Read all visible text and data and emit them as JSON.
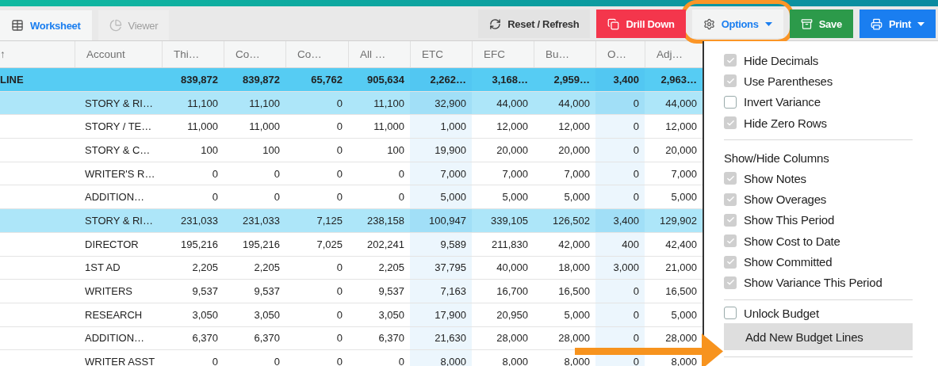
{
  "tabs": [
    {
      "label": "Worksheet",
      "selected": true
    },
    {
      "label": "Viewer",
      "selected": false
    }
  ],
  "toolbar": [
    {
      "label": "Reset / Refresh",
      "kind": "reset"
    },
    {
      "label": "Drill Down",
      "kind": "drill"
    },
    {
      "label": "Options",
      "kind": "options",
      "caret": true,
      "emphasized": true
    },
    {
      "label": "Save",
      "kind": "save"
    },
    {
      "label": "Print",
      "kind": "print",
      "caret": true
    }
  ],
  "table": {
    "columns": [
      "↑",
      "Account",
      "Thi…",
      "Co…",
      "Co…",
      "All …",
      "ETC",
      "EFC",
      "Bu…",
      "O…",
      "Adj…"
    ],
    "rows": [
      {
        "kind": "total",
        "cells": [
          "LINE",
          "",
          "839,872",
          "839,872",
          "65,762",
          "905,634",
          "2,262…",
          "3,168…",
          "2,959…",
          "3,400",
          "2,963…"
        ]
      },
      {
        "kind": "group",
        "cells": [
          "",
          "STORY & RI…",
          "11,100",
          "11,100",
          "0",
          "11,100",
          "32,900",
          "44,000",
          "44,000",
          "0",
          "44,000"
        ]
      },
      {
        "kind": "line",
        "cells": [
          "",
          "STORY / TE…",
          "11,000",
          "11,000",
          "0",
          "11,000",
          "1,000",
          "12,000",
          "12,000",
          "0",
          "12,000"
        ]
      },
      {
        "kind": "line",
        "cells": [
          "",
          "STORY & C…",
          "100",
          "100",
          "0",
          "100",
          "19,900",
          "20,000",
          "20,000",
          "0",
          "20,000"
        ]
      },
      {
        "kind": "line",
        "cells": [
          "",
          "WRITER'S R…",
          "0",
          "0",
          "0",
          "0",
          "7,000",
          "7,000",
          "7,000",
          "0",
          "7,000"
        ]
      },
      {
        "kind": "line",
        "cells": [
          "",
          "ADDITION…",
          "0",
          "0",
          "0",
          "0",
          "5,000",
          "5,000",
          "5,000",
          "0",
          "5,000"
        ]
      },
      {
        "kind": "group",
        "cells": [
          "",
          "STORY & RI…",
          "231,033",
          "231,033",
          "7,125",
          "238,158",
          "100,947",
          "339,105",
          "126,502",
          "3,400",
          "129,902"
        ]
      },
      {
        "kind": "line",
        "cells": [
          "",
          "DIRECTOR",
          "195,216",
          "195,216",
          "7,025",
          "202,241",
          "9,589",
          "211,830",
          "42,000",
          "400",
          "42,400"
        ]
      },
      {
        "kind": "line",
        "cells": [
          "",
          "1ST AD",
          "2,205",
          "2,205",
          "0",
          "2,205",
          "37,795",
          "40,000",
          "18,000",
          "3,000",
          "21,000"
        ]
      },
      {
        "kind": "line",
        "cells": [
          "",
          "WRITERS",
          "9,537",
          "9,537",
          "0",
          "9,537",
          "7,163",
          "16,700",
          "16,500",
          "0",
          "16,500"
        ]
      },
      {
        "kind": "line",
        "cells": [
          "",
          "RESEARCH",
          "3,050",
          "3,050",
          "0",
          "3,050",
          "17,900",
          "20,950",
          "5,000",
          "0",
          "5,000"
        ]
      },
      {
        "kind": "line",
        "cells": [
          "",
          "ADDITION…",
          "6,370",
          "6,370",
          "0",
          "6,370",
          "21,630",
          "28,000",
          "28,000",
          "0",
          "28,000"
        ]
      },
      {
        "kind": "line",
        "cells": [
          "",
          "WRITER ASST",
          "0",
          "0",
          "0",
          "0",
          "8,000",
          "8,000",
          "8,000",
          "0",
          "8,000"
        ]
      }
    ]
  },
  "menu": {
    "sections": [
      {
        "items": [
          {
            "kind": "checkbox",
            "label": "Hide Decimals",
            "checked": true
          },
          {
            "kind": "checkbox",
            "label": "Use Parentheses",
            "checked": true
          },
          {
            "kind": "checkbox",
            "label": "Invert Variance",
            "checked": false
          },
          {
            "kind": "checkbox",
            "label": "Hide Zero Rows",
            "checked": true
          }
        ]
      },
      {
        "heading": "Show/Hide Columns",
        "items": [
          {
            "kind": "checkbox",
            "label": "Show Notes",
            "checked": true
          },
          {
            "kind": "checkbox",
            "label": "Show Overages",
            "checked": true
          },
          {
            "kind": "checkbox",
            "label": "Show This Period",
            "checked": true
          },
          {
            "kind": "checkbox",
            "label": "Show Cost to Date",
            "checked": true
          },
          {
            "kind": "checkbox",
            "label": "Show Committed",
            "checked": true
          },
          {
            "kind": "checkbox",
            "label": "Show Variance This Period",
            "checked": true
          }
        ]
      },
      {
        "items": [
          {
            "kind": "checkbox",
            "label": "Unlock Budget",
            "checked": false
          },
          {
            "kind": "action",
            "label": "Add New Budget Lines",
            "highlighted": true
          }
        ]
      }
    ]
  },
  "callout": {
    "kind": "arrow"
  }
}
